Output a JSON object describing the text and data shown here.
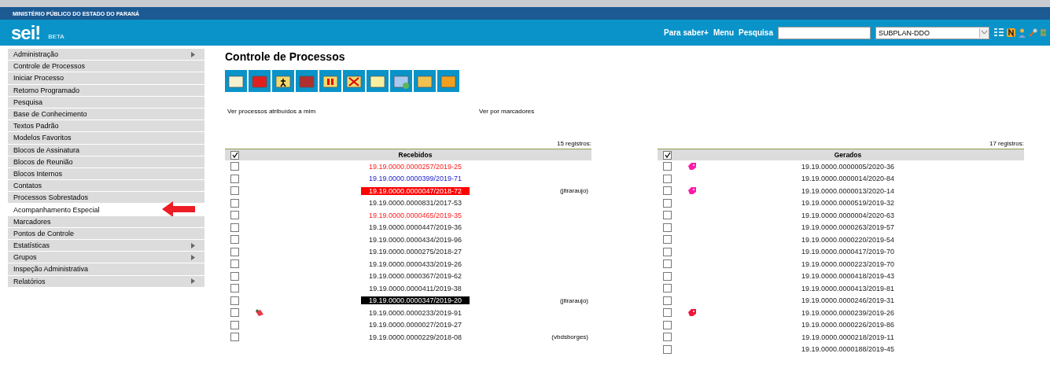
{
  "header": {
    "org": "MINISTÉRIO PÚBLICO DO ESTADO DO PARANÁ",
    "logo": "sei!",
    "badge": "BETA",
    "links": [
      "Para saber+",
      "Menu",
      "Pesquisa"
    ],
    "unit_select": {
      "value": "SUBPLAN-DDO"
    }
  },
  "sidebar": {
    "items": [
      {
        "label": "Administração",
        "submenu": true,
        "selected": false
      },
      {
        "label": "Controle de Processos",
        "submenu": false,
        "selected": false
      },
      {
        "label": "Iniciar Processo",
        "submenu": false,
        "selected": false
      },
      {
        "label": "Retorno Programado",
        "submenu": false,
        "selected": false
      },
      {
        "label": "Pesquisa",
        "submenu": false,
        "selected": false
      },
      {
        "label": "Base de Conhecimento",
        "submenu": false,
        "selected": false
      },
      {
        "label": "Textos Padrão",
        "submenu": false,
        "selected": false
      },
      {
        "label": "Modelos Favoritos",
        "submenu": false,
        "selected": false
      },
      {
        "label": "Blocos de Assinatura",
        "submenu": false,
        "selected": false
      },
      {
        "label": "Blocos de Reunião",
        "submenu": false,
        "selected": false
      },
      {
        "label": "Blocos Internos",
        "submenu": false,
        "selected": false
      },
      {
        "label": "Contatos",
        "submenu": false,
        "selected": false
      },
      {
        "label": "Processos Sobrestados",
        "submenu": false,
        "selected": false
      },
      {
        "label": "Acompanhamento Especial",
        "submenu": false,
        "selected": true
      },
      {
        "label": "Marcadores",
        "submenu": false,
        "selected": false
      },
      {
        "label": "Pontos de Controle",
        "submenu": false,
        "selected": false
      },
      {
        "label": "Estatísticas",
        "submenu": true,
        "selected": false
      },
      {
        "label": "Grupos",
        "submenu": true,
        "selected": false
      },
      {
        "label": "Inspeção Administrativa",
        "submenu": false,
        "selected": false
      },
      {
        "label": "Relatórios",
        "submenu": true,
        "selected": false
      }
    ]
  },
  "main": {
    "title": "Controle de Processos",
    "links": [
      "Ver processos atribuídos a mim",
      "Ver por marcadores"
    ],
    "tables": [
      {
        "count": "15 registros:",
        "heading": "Recebidos",
        "all_checked": true,
        "rows": [
          {
            "number": "19.19.0000.0000257/2019-25",
            "kind": "red",
            "checked": false
          },
          {
            "number": "19.19.0000.0000399/2019-71",
            "kind": "blue",
            "checked": false
          },
          {
            "number": "19.19.0000.0000047/2018-72",
            "kind": "red-highlight",
            "checked": false,
            "user": "(jltraraujo)"
          },
          {
            "number": "19.19.0000.0000831/2017-53",
            "kind": "plain",
            "checked": false
          },
          {
            "number": "19.19.0000.0000465/2019-35",
            "kind": "red",
            "checked": false
          },
          {
            "number": "19.19.0000.0000447/2019-36",
            "kind": "plain",
            "checked": false
          },
          {
            "number": "19.19.0000.0000434/2019-96",
            "kind": "plain",
            "checked": false
          },
          {
            "number": "19.19.0000.0000275/2018-27",
            "kind": "plain",
            "checked": false
          },
          {
            "number": "19.19.0000.0000433/2019-26",
            "kind": "plain",
            "checked": false
          },
          {
            "number": "19.19.0000.0000367/2019-62",
            "kind": "plain",
            "checked": false
          },
          {
            "number": "19.19.0000.0000411/2019-38",
            "kind": "plain",
            "checked": false
          },
          {
            "number": "19.19.0000.0000347/2019-20",
            "kind": "black-highlight",
            "checked": false,
            "user": "(jltraraujo)"
          },
          {
            "number": "19.19.0000.0000233/2019-91",
            "kind": "plain",
            "checked": false,
            "marker": {
              "kind": "note",
              "color": "#e8384a"
            }
          },
          {
            "number": "19.19.0000.0000027/2019-27",
            "kind": "plain",
            "checked": false
          },
          {
            "number": "19.19.0000.0000229/2018-08",
            "kind": "plain",
            "checked": false,
            "user": "(vbdsborges)"
          }
        ]
      },
      {
        "count": "17 registros:",
        "heading": "Gerados",
        "all_checked": true,
        "rows": [
          {
            "number": "19.19.0000.0000005/2020-36",
            "kind": "plain",
            "checked": false,
            "marker": {
              "kind": "tag",
              "color": "#ff1aa8"
            }
          },
          {
            "number": "19.19.0000.0000014/2020-84",
            "kind": "plain",
            "checked": false
          },
          {
            "number": "19.19.0000.0000013/2020-14",
            "kind": "plain",
            "checked": false,
            "marker": {
              "kind": "tag",
              "color": "#ff1aa8"
            }
          },
          {
            "number": "19.19.0000.0000519/2019-32",
            "kind": "plain",
            "checked": false
          },
          {
            "number": "19.19.0000.0000004/2020-63",
            "kind": "plain",
            "checked": false
          },
          {
            "number": "19.19.0000.0000263/2019-57",
            "kind": "plain",
            "checked": false
          },
          {
            "number": "19.19.0000.0000220/2019-54",
            "kind": "plain",
            "checked": false
          },
          {
            "number": "19.19.0000.0000417/2019-70",
            "kind": "plain",
            "checked": false
          },
          {
            "number": "19.19.0000.0000223/2019-70",
            "kind": "plain",
            "checked": false
          },
          {
            "number": "19.19.0000.0000418/2019-43",
            "kind": "plain",
            "checked": false
          },
          {
            "number": "19.19.0000.0000413/2019-81",
            "kind": "plain",
            "checked": false
          },
          {
            "number": "19.19.0000.0000246/2019-31",
            "kind": "plain",
            "checked": false
          },
          {
            "number": "19.19.0000.0000239/2019-26",
            "kind": "plain",
            "checked": false,
            "marker": {
              "kind": "tag",
              "color": "#f0143c"
            }
          },
          {
            "number": "19.19.0000.0000226/2019-86",
            "kind": "plain",
            "checked": false
          },
          {
            "number": "19.19.0000.0000218/2019-11",
            "kind": "plain",
            "checked": false
          },
          {
            "number": "19.19.0000.0000188/2019-45",
            "kind": "plain",
            "checked": false
          }
        ]
      }
    ]
  }
}
